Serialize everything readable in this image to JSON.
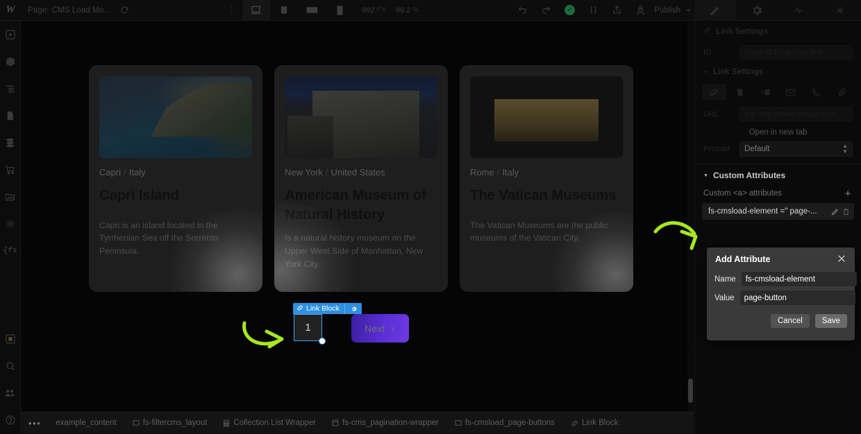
{
  "topbar": {
    "logo": "W",
    "page_prefix": "Page:",
    "page_name": "CMS Load Mo...",
    "refresh_icon": "refresh-icon",
    "devices": [
      {
        "name": "desktop-breakpoint",
        "icon": "desktop-icon",
        "active": true
      },
      {
        "name": "tablet-breakpoint",
        "icon": "tablet-icon",
        "active": false
      },
      {
        "name": "mobile-landscape-breakpoint",
        "icon": "mobile-landscape-icon",
        "active": false
      },
      {
        "name": "mobile-portrait-breakpoint",
        "icon": "mobile-portrait-icon",
        "active": false
      }
    ],
    "px_value": "992",
    "px_unit": "PX",
    "zoom_value": "99.2",
    "zoom_unit": "%",
    "undo_icon": "undo-icon",
    "redo_icon": "redo-icon",
    "status_icon": "check-circle-icon",
    "code_icon": "code-parens-icon",
    "share_icon": "share-icon",
    "publish_icon": "rocket-icon",
    "publish_label": "Publish",
    "publish_chevron": "chevron-down-icon",
    "panel_icons": [
      "style-brush-icon",
      "settings-gear-icon",
      "interactions-icon",
      "asterisk-icon"
    ]
  },
  "sidebar": {
    "items": [
      {
        "name": "add-elements",
        "icon": "plus-box-icon"
      },
      {
        "name": "components",
        "icon": "cube-icon"
      },
      {
        "name": "navigator",
        "icon": "layers-list-icon"
      },
      {
        "name": "pages",
        "icon": "page-icon"
      },
      {
        "name": "cms",
        "icon": "database-icon"
      },
      {
        "name": "ecommerce",
        "icon": "cart-icon"
      },
      {
        "name": "assets",
        "icon": "image-folder-icon"
      },
      {
        "name": "settings",
        "icon": "sun-gear-icon"
      },
      {
        "name": "finsweet-extension",
        "icon": "fs-brackets-icon"
      },
      {
        "name": "apps",
        "icon": "app-window-icon"
      },
      {
        "name": "search",
        "icon": "search-icon"
      },
      {
        "name": "collaborators",
        "icon": "people-icon"
      },
      {
        "name": "help",
        "icon": "help-circle-icon"
      }
    ]
  },
  "canvas": {
    "cards": [
      {
        "image": "capri-coastline-photo",
        "location": "Capri",
        "country": "Italy",
        "title": "Capri Island",
        "description": "Capri is an island located in the Tyrrhenian Sea off the Sorrento Peninsula."
      },
      {
        "image": "american-museum-facade-photo",
        "location": "New York",
        "country": "United States",
        "title": "American Museum of Natural History",
        "description": "Is a natural history museum on the Upper West Side of Manhattan, New York City."
      },
      {
        "image": "vatican-basilica-night-photo",
        "location": "Rome",
        "country": "Italy",
        "title": "The Vatican Museums",
        "description": "The Vatican Museums are the public museums of the Vatican City."
      }
    ],
    "separator": "/",
    "pagination": {
      "selected_badge": "Link Block",
      "badge_link_icon": "link-chain-icon",
      "badge_gear_icon": "gear-icon",
      "page_number": "1",
      "next_label": "Next",
      "next_chevron": "chevron-right-icon"
    },
    "annotations": [
      {
        "name": "arrow-to-attribute-list",
        "color": "#a7e820"
      },
      {
        "name": "arrow-to-page-button",
        "color": "#a7e820"
      }
    ]
  },
  "right_panel": {
    "header_title": "Link Settings",
    "header_icon": "link-settings-icon",
    "id_label": "ID",
    "id_placeholder": "Enter ID for anchor link",
    "link_settings_label": "Link Settings",
    "link_types": [
      {
        "name": "link-type-url",
        "icon": "link-chain-icon",
        "selected": true
      },
      {
        "name": "link-type-page",
        "icon": "page-icon",
        "selected": false
      },
      {
        "name": "link-type-section",
        "icon": "section-anchor-icon",
        "selected": false
      },
      {
        "name": "link-type-email",
        "icon": "envelope-icon",
        "selected": false
      },
      {
        "name": "link-type-phone",
        "icon": "phone-icon",
        "selected": false
      },
      {
        "name": "link-type-attachment",
        "icon": "paperclip-icon",
        "selected": false
      }
    ],
    "url_label": "URL",
    "url_placeholder": "e.g. http://www.google.com",
    "open_new_tab_label": "Open in new tab",
    "preload_label": "Preload",
    "preload_value": "Default",
    "custom_attributes_title": "Custom Attributes",
    "custom_attributes_sub": "Custom <a> attributes",
    "add_attribute_icon": "plus-icon",
    "attribute_item": {
      "text": "fs-cmsload-element =\" page-...",
      "edit_icon": "pencil-icon",
      "delete_icon": "trash-icon"
    }
  },
  "add_attribute_dialog": {
    "title": "Add Attribute",
    "close_icon": "close-x-icon",
    "name_label": "Name",
    "name_value": "fs-cmsload-element",
    "value_label": "Value",
    "value_value": "page-button",
    "cancel_label": "Cancel",
    "save_label": "Save"
  },
  "breadcrumb": {
    "overflow": "•••",
    "items": [
      {
        "label": "example_content",
        "icon": null
      },
      {
        "label": "fs-filtercms_layout",
        "icon": "div-block-icon"
      },
      {
        "label": "Collection List Wrapper",
        "icon": "collection-list-icon"
      },
      {
        "label": "fs-cms_pagination-wrapper",
        "icon": "form-block-icon"
      },
      {
        "label": "fs-cmsload_page-buttons",
        "icon": "div-block-icon"
      },
      {
        "label": "Link Block",
        "icon": "link-chain-icon"
      }
    ]
  },
  "colors": {
    "selection_blue": "#2f8fe0",
    "annotation_green": "#a7e820",
    "next_button_purple": "#5b2fd6",
    "publish_check_green": "#1d6b3c"
  }
}
